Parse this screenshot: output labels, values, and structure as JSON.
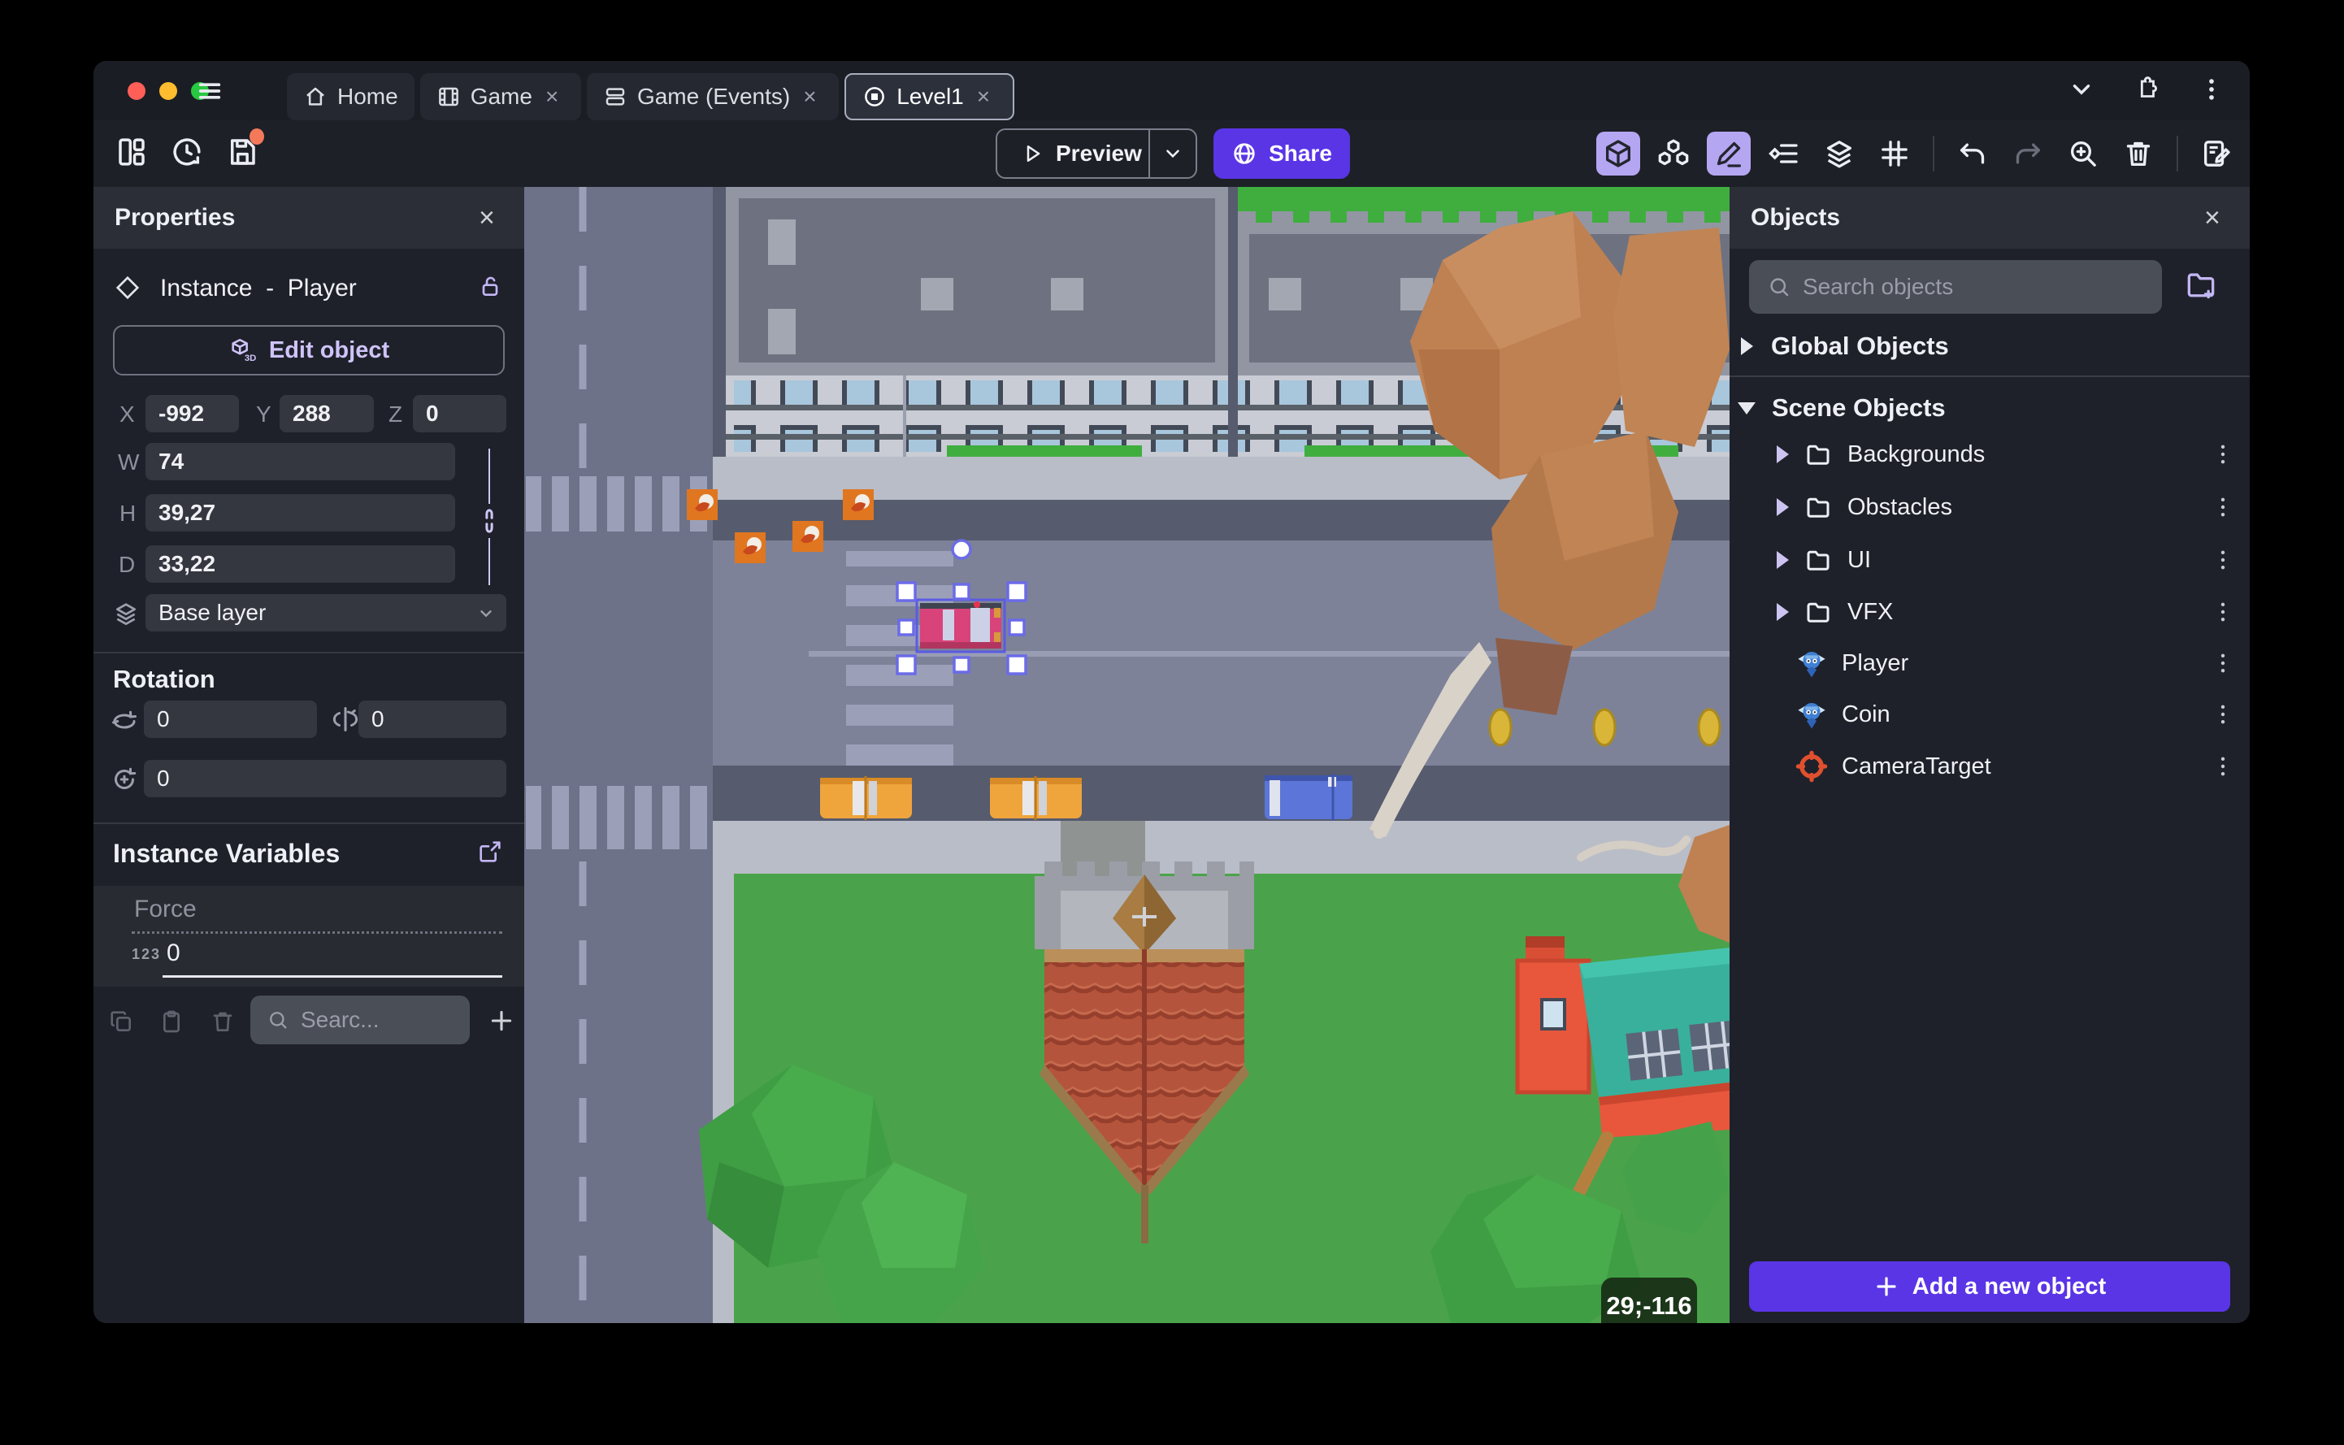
{
  "window": {
    "traffic_lights": [
      "#ff5f57",
      "#febc2e",
      "#28c840"
    ]
  },
  "titlebar": {
    "tabs": [
      {
        "label": "Home"
      },
      {
        "label": "Game",
        "close": "×"
      },
      {
        "label": "Game (Events)",
        "close": "×"
      },
      {
        "label": "Level1",
        "close": "×"
      }
    ]
  },
  "toolbar": {
    "preview_label": "Preview",
    "share_label": "Share"
  },
  "properties_panel": {
    "title": "Properties",
    "close": "×",
    "instance_label": "Instance",
    "dash": "-",
    "object_name": "Player",
    "edit_object_label": "Edit object",
    "x_label": "X",
    "x_value": "-992",
    "y_label": "Y",
    "y_value": "288",
    "z_label": "Z",
    "z_value": "0",
    "w_label": "W",
    "w_value": "74",
    "h_label": "H",
    "h_value": "39,27",
    "d_label": "D",
    "d_value": "33,22",
    "layer_value": "Base layer",
    "rotation_title": "Rotation",
    "rot_x_value": "0",
    "rot_y_value": "0",
    "rot_z_value": "0",
    "instance_variables_title": "Instance Variables",
    "variable_name": "Force",
    "variable_type_badge": "123",
    "variable_value": "0",
    "variables_search_placeholder": "Searc..."
  },
  "objects_panel": {
    "title": "Objects",
    "close": "×",
    "search_placeholder": "Search objects",
    "global_group_label": "Global Objects",
    "scene_group_label": "Scene Objects",
    "folders": [
      "Backgrounds",
      "Obstacles",
      "UI",
      "VFX"
    ],
    "objects": [
      {
        "name": "Player"
      },
      {
        "name": "Coin"
      },
      {
        "name": "CameraTarget"
      }
    ],
    "add_button_label": "Add a new object"
  },
  "viewport": {
    "coords_badge": "29;-116"
  },
  "colors": {
    "accent": "#5a35e6",
    "accent_light": "#b5a6f2",
    "selection": "#6b6be8"
  }
}
